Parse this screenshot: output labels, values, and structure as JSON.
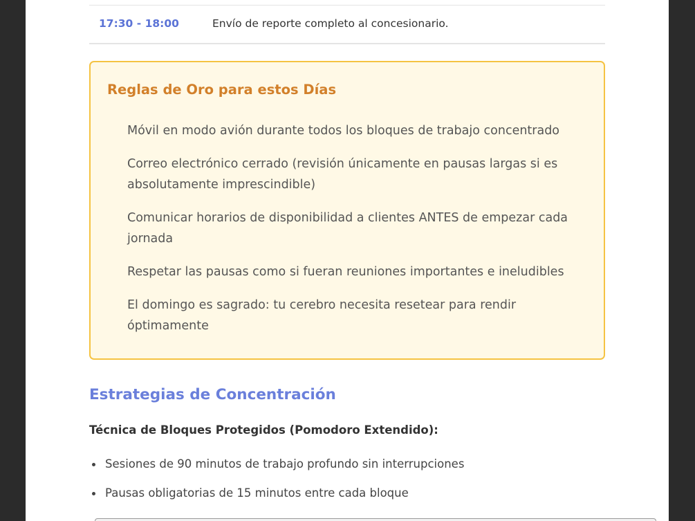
{
  "schedule": {
    "rows": [
      {
        "time": "17:30 - 18:00",
        "description": "Envío de reporte completo al concesionario."
      }
    ]
  },
  "golden_rules": {
    "title": "Reglas de Oro para estos Días",
    "items": [
      "Móvil en modo avión durante todos los bloques de trabajo concentrado",
      "Correo electrónico cerrado (revisión únicamente en pausas largas si es absolutamente imprescindible)",
      "Comunicar horarios de disponibilidad a clientes ANTES de empezar cada jornada",
      "Respetar las pausas como si fueran reuniones importantes e ineludibles",
      "El domingo es sagrado: tu cerebro necesita resetear para rendir óptimamente"
    ]
  },
  "strategies": {
    "title": "Estrategias de Concentración",
    "subheading": "Técnica de Bloques Protegidos (Pomodoro Extendido):",
    "items": [
      "Sesiones de 90 minutos de trabajo profundo sin interrupciones",
      "Pausas obligatorias de 15 minutos entre cada bloque"
    ]
  },
  "colors": {
    "accent_blue": "#6a7fdb",
    "time_blue": "#5b73d6",
    "rules_title_orange": "#d2802a",
    "rules_border": "#f5c342",
    "rules_background": "#fff9e6"
  }
}
